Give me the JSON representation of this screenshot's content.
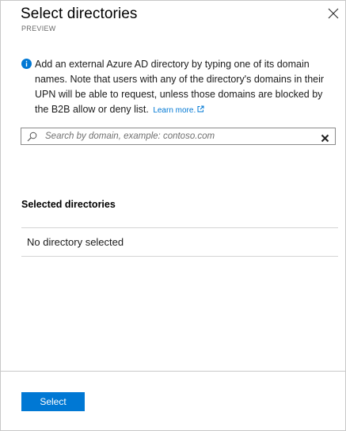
{
  "header": {
    "title": "Select directories",
    "subtitle": "PREVIEW"
  },
  "info": {
    "text": "Add an external Azure AD directory by typing one of its domain names. Note that users with any of the directory's domains in their UPN will be able to request, unless those domains are blocked by the B2B allow or deny list.",
    "link_label": "Learn more."
  },
  "search": {
    "placeholder": "Search by domain, example: contoso.com",
    "value": ""
  },
  "selected": {
    "heading": "Selected directories",
    "empty_text": "No directory selected"
  },
  "footer": {
    "select_label": "Select"
  },
  "colors": {
    "accent": "#0078d4",
    "info_icon": "#0078d4"
  },
  "icons": {
    "close": "close-icon",
    "info": "info-icon",
    "external_link": "external-link-icon",
    "search": "search-icon",
    "clear": "clear-icon"
  }
}
